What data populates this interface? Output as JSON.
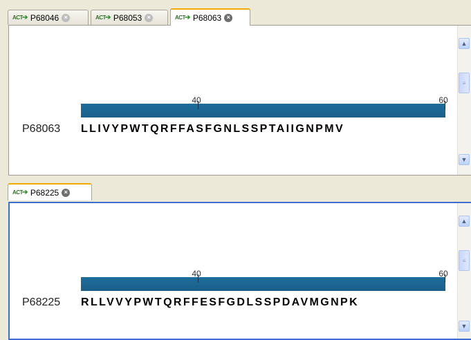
{
  "top_tabs": [
    {
      "label": "P68046",
      "icon": "sequence-icon",
      "icon_text": "ACT",
      "active": false
    },
    {
      "label": "P68053",
      "icon": "sequence-icon",
      "icon_text": "ACT",
      "active": false
    },
    {
      "label": "P68063",
      "icon": "sequence-icon",
      "icon_text": "ACT",
      "active": true
    }
  ],
  "bottom_tabs": [
    {
      "label": "P68225",
      "icon": "sequence-icon",
      "icon_text": "ACT",
      "active": true
    }
  ],
  "top_view": {
    "sequence_name": "P68063",
    "sequence": "LLIVYPWTQRFFASFGNLSSPTAIIGNPMV",
    "ruler_labels": [
      "40",
      "60"
    ]
  },
  "bottom_view": {
    "sequence_name": "P68225",
    "sequence": "RLLVVYPWTQRFFESFGDLSSPDAVMGNPK",
    "ruler_labels": [
      "40",
      "60"
    ]
  }
}
